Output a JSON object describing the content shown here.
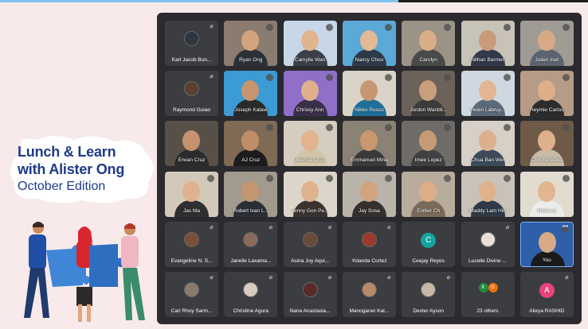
{
  "event": {
    "line1": "Lunch & Learn",
    "line2": "with Alister Ong",
    "line3": "October Edition"
  },
  "participants": [
    {
      "name": "Karl Jacob Bun...",
      "camera": false,
      "avatar_color": "#2f3640",
      "mic_muted": true
    },
    {
      "name": "Ryan Ong",
      "camera": true,
      "bg": "#8a7c6e",
      "skin": "#d2a47e",
      "shirt": "#2c3138"
    },
    {
      "name": "Camylle Wan",
      "camera": true,
      "bg": "#c7d7e8",
      "skin": "#e0b48f",
      "shirt": "#3a3f48"
    },
    {
      "name": "Nancy Chou",
      "camera": true,
      "bg": "#5aa9d6",
      "skin": "#e4b995",
      "shirt": "#2e3a4a"
    },
    {
      "name": "Carolyn",
      "camera": true,
      "bg": "#9a9386",
      "skin": "#d9ad88",
      "shirt": "#4a4a4a"
    },
    {
      "name": "Nilhan Barmer",
      "camera": true,
      "bg": "#c8c3b9",
      "skin": "#c99b78",
      "shirt": "#32394a"
    },
    {
      "name": "Julien Inet",
      "camera": true,
      "bg": "#a09c94",
      "skin": "#d7aa86",
      "shirt": "#5b6470"
    },
    {
      "name": "Raymond Guiao",
      "camera": false,
      "avatar_color": "#5a4030",
      "mic_muted": true
    },
    {
      "name": "Joseph Kalaw",
      "camera": true,
      "bg": "#3d9bd3",
      "skin": "#c9956f",
      "shirt": "#2a2a2a"
    },
    {
      "name": "Chrissy Ann",
      "camera": true,
      "bg": "#8f6fc8",
      "skin": "#e0b08c",
      "shirt": "#3a2f4a"
    },
    {
      "name": "Nikko Rosco",
      "camera": true,
      "bg": "#d9d3c8",
      "skin": "#c79773",
      "shirt": "#1e6f9a"
    },
    {
      "name": "Jordon Wanbli...",
      "camera": true,
      "bg": "#6c625a",
      "skin": "#c9a07c",
      "shirt": "#3b3b3b"
    },
    {
      "name": "Helen Labruy...",
      "camera": true,
      "bg": "#cfd8e0",
      "skin": "#e2b692",
      "shirt": "#5a6a7a"
    },
    {
      "name": "Reymie Carlos",
      "camera": true,
      "bg": "#b69b86",
      "skin": "#dcae8a",
      "shirt": "#2c2c2c"
    },
    {
      "name": "Erwan Cruz",
      "camera": true,
      "bg": "#585047",
      "skin": "#c49270",
      "shirt": "#2b2b2b"
    },
    {
      "name": "AJ Cruz",
      "camera": true,
      "bg": "#7e6a55",
      "skin": "#c08d69",
      "shirt": "#1c1c1c"
    },
    {
      "name": "Bianca Cruz",
      "camera": true,
      "bg": "#d5cdbf",
      "skin": "#e1b38e",
      "shirt": "#d1c4a8"
    },
    {
      "name": "Emmanuel Mina",
      "camera": true,
      "bg": "#8b8276",
      "skin": "#c9986f",
      "shirt": "#3a3a3a"
    },
    {
      "name": "Imee Lopez",
      "camera": true,
      "bg": "#6f6c68",
      "skin": "#c79a77",
      "shirt": "#404040"
    },
    {
      "name": "Chua Ban Wei",
      "camera": true,
      "bg": "#d6d0c7",
      "skin": "#dcb08b",
      "shirt": "#3c4a5a"
    },
    {
      "name": "Christie Maes",
      "camera": true,
      "bg": "#6f5a48",
      "skin": "#deb08c",
      "shirt": "#c7bba6"
    },
    {
      "name": "Jas Ma",
      "camera": true,
      "bg": "#d3c9bb",
      "skin": "#dfb28d",
      "shirt": "#2f2f2f"
    },
    {
      "name": "Robert Ivan L...",
      "camera": true,
      "bg": "#a39a8e",
      "skin": "#c49571",
      "shirt": "#2a2f36"
    },
    {
      "name": "Jenny Gon Pe...",
      "camera": true,
      "bg": "#dcd5ca",
      "skin": "#dfb38f",
      "shirt": "#3a3330"
    },
    {
      "name": "Jay Sosa",
      "camera": true,
      "bg": "#b9b3aa",
      "skin": "#d2a47f",
      "shirt": "#35302c"
    },
    {
      "name": "Esther Ch",
      "camera": true,
      "bg": "#b8ad9d",
      "skin": "#dcae88",
      "shirt": "#7a6a5a"
    },
    {
      "name": "Maddy Lam Hin",
      "camera": true,
      "bg": "#c9c2b8",
      "skin": "#e0b28c",
      "shirt": "#2f3a48"
    },
    {
      "name": "Hiciu Lu",
      "camera": true,
      "bg": "#e2dbd0",
      "skin": "#e2b690",
      "shirt": "#ecece8"
    },
    {
      "name": "Evangeline N. S...",
      "camera": false,
      "avatar_color": "#7a5038",
      "mic_muted": true
    },
    {
      "name": "Janelle Laxama...",
      "camera": false,
      "avatar_color": "#8a6a5a",
      "mic_muted": true
    },
    {
      "name": "Asina Joy Aqui...",
      "camera": false,
      "avatar_color": "#6a4a3a",
      "mic_muted": true
    },
    {
      "name": "Yolanda Cortez",
      "camera": false,
      "avatar_color": "#9a3a2a",
      "mic_muted": true
    },
    {
      "name": "Ceejay Reyes",
      "camera": false,
      "letter": "C",
      "letter_color": "#12a4a0",
      "mic_muted": false
    },
    {
      "name": "Lucelle Divine ...",
      "camera": false,
      "avatar_color": "#e8e0d8",
      "mic_muted": true
    },
    {
      "name": "You",
      "camera": true,
      "you": true,
      "bg": "#2e5fa8",
      "skin": "#d8aa86",
      "shirt": "#1a1a1a"
    },
    {
      "name": "Carl Rhoy Sarm...",
      "camera": false,
      "avatar_color": "#8a7a6a",
      "mic_muted": true
    },
    {
      "name": "Christine Agura",
      "camera": false,
      "avatar_color": "#d8ccc0",
      "mic_muted": true
    },
    {
      "name": "Nana Anastasia...",
      "camera": false,
      "avatar_color": "#5a2a2a",
      "mic_muted": true
    },
    {
      "name": "Manogaran Kat...",
      "camera": false,
      "avatar_color": "#b88a6a",
      "mic_muted": true
    },
    {
      "name": "Dexter Ayson",
      "camera": false,
      "avatar_color": "#c8b8a8",
      "mic_muted": true
    },
    {
      "name": "23 others",
      "camera": false,
      "others": true,
      "others_letters": [
        "K",
        "G"
      ],
      "others_colors": [
        "#1e8e3e",
        "#e8710a"
      ]
    },
    {
      "name": "Alieya RASHID",
      "camera": false,
      "letter": "A",
      "letter_color": "#e8437a",
      "mic_muted": true
    }
  ]
}
